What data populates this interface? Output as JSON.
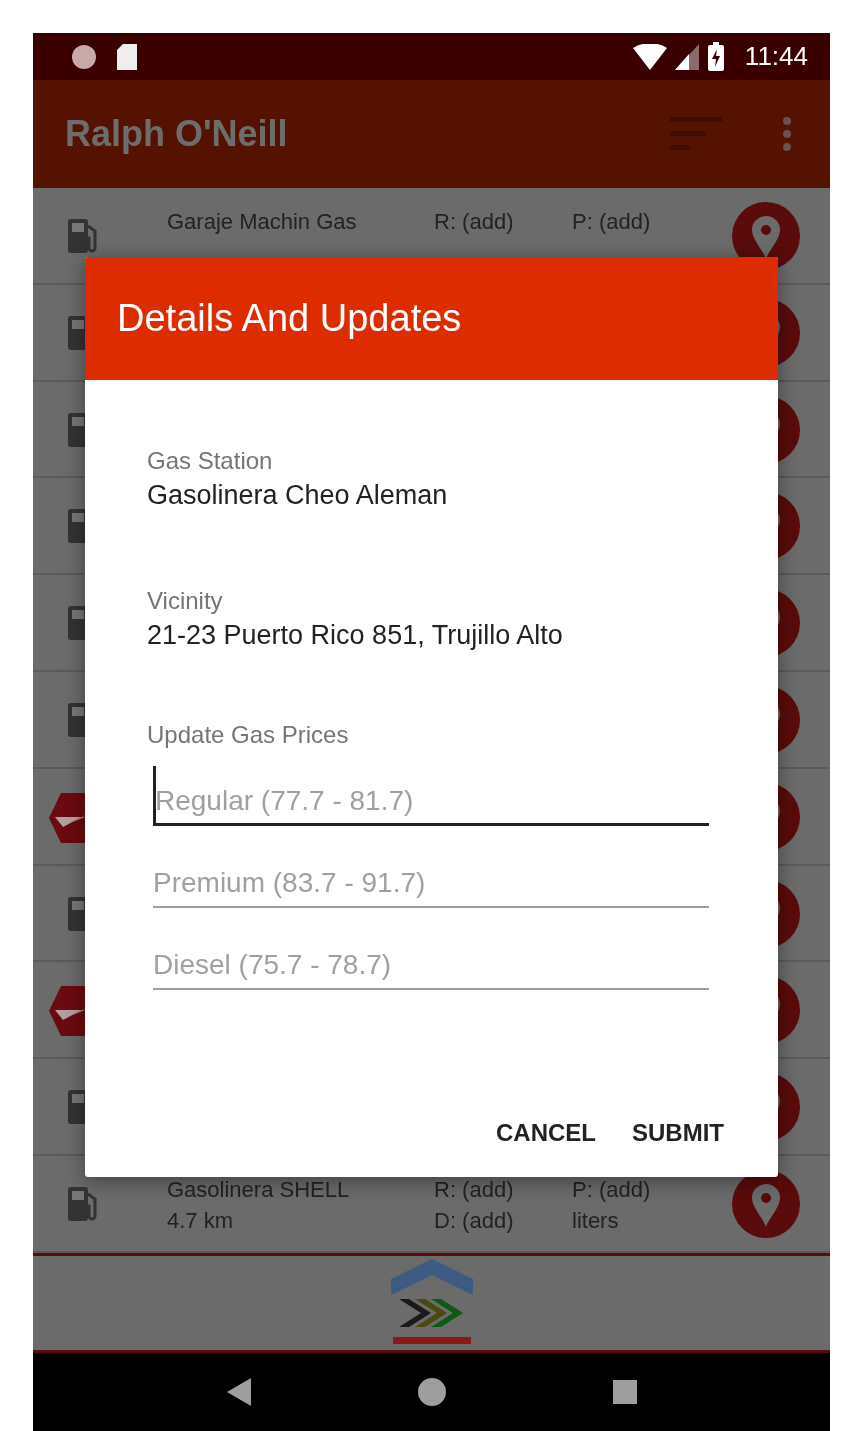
{
  "status_bar": {
    "time": "11:44"
  },
  "app_bar": {
    "title": "Ralph O'Neill"
  },
  "stations": [
    {
      "kind": "pump",
      "name": "Garaje Machin Gas",
      "regular": "R: (add)",
      "premium": "P: (add)"
    },
    {
      "kind": "pump"
    },
    {
      "kind": "pump"
    },
    {
      "kind": "pump"
    },
    {
      "kind": "pump"
    },
    {
      "kind": "pump"
    },
    {
      "kind": "brand"
    },
    {
      "kind": "pump"
    },
    {
      "kind": "brand"
    },
    {
      "kind": "pump"
    },
    {
      "kind": "pump",
      "name": "Gasolinera SHELL",
      "distance": "4.7 km",
      "regular": "R: (add)",
      "diesel": "D: (add)",
      "premium": "P: (add)",
      "unit": "liters"
    }
  ],
  "dialog": {
    "title": "Details And Updates",
    "details": [
      {
        "label": "Gas Station",
        "value": "Gasolinera Cheo Aleman"
      },
      {
        "label": "Vicinity",
        "value": "21-23 Puerto Rico 851, Trujillo Alto"
      }
    ],
    "prices_label": "Update Gas Prices",
    "fields": [
      {
        "placeholder": "Regular (77.7 - 81.7)",
        "focused": true
      },
      {
        "placeholder": "Premium (83.7 - 91.7)",
        "focused": false
      },
      {
        "placeholder": "Diesel (75.7 - 78.7)",
        "focused": false
      }
    ],
    "buttons": [
      "CANCEL",
      "SUBMIT"
    ]
  }
}
